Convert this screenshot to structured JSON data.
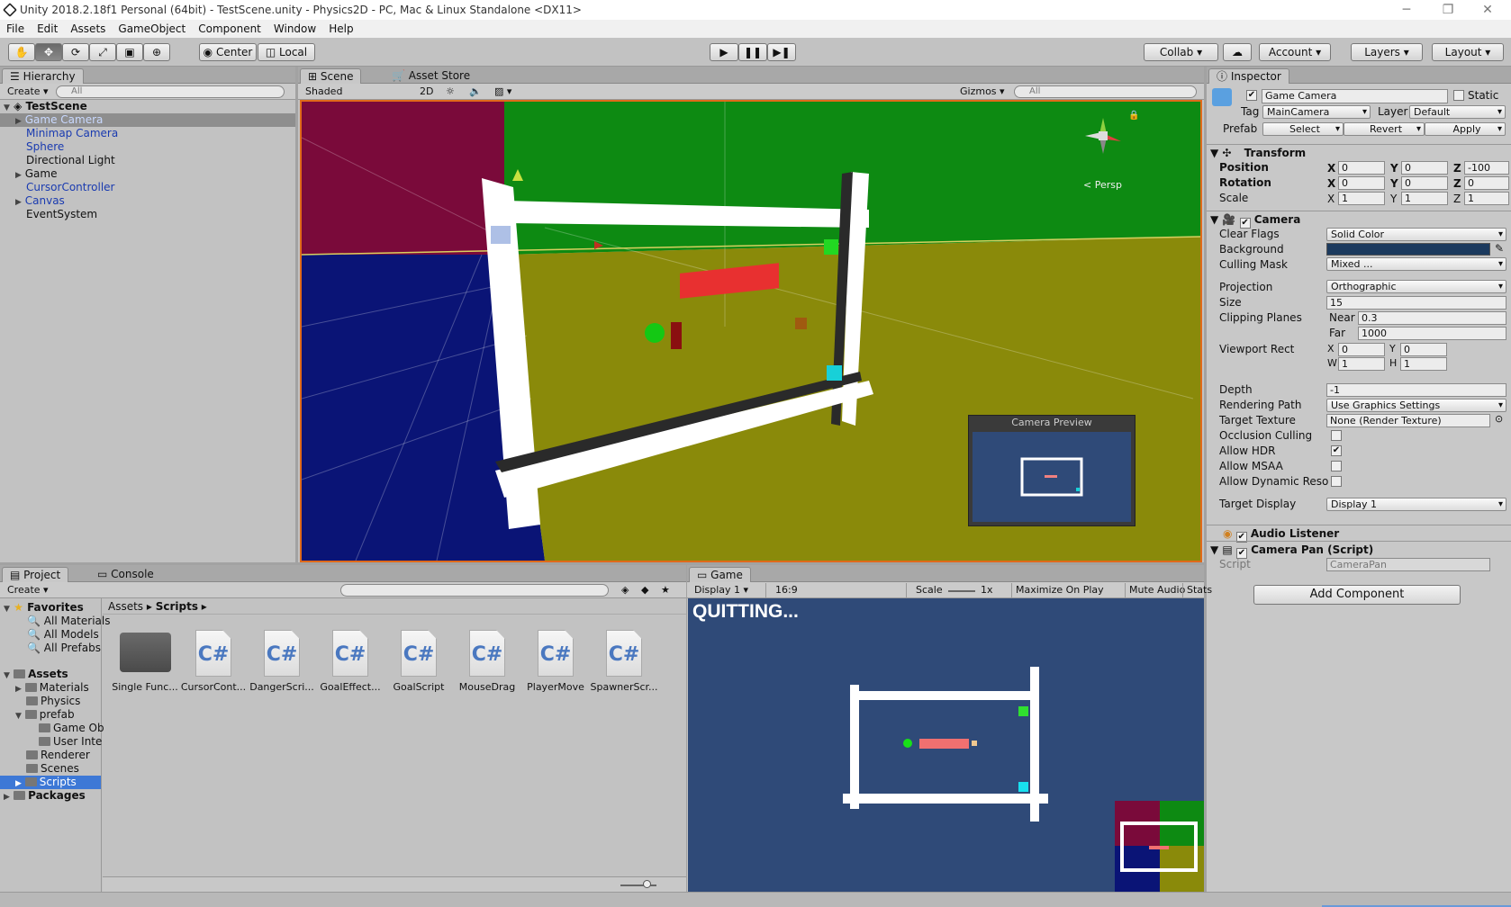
{
  "window": {
    "title": "Unity 2018.2.18f1 Personal (64bit) - TestScene.unity - Physics2D - PC, Mac & Linux Standalone <DX11>"
  },
  "menu": [
    "File",
    "Edit",
    "Assets",
    "GameObject",
    "Component",
    "Window",
    "Help"
  ],
  "toolbar": {
    "center": "Center",
    "local": "Local",
    "collab": "Collab",
    "account": "Account",
    "layers": "Layers",
    "layout": "Layout"
  },
  "hierarchy": {
    "tab": "Hierarchy",
    "create": "Create",
    "search": "All",
    "scene": "TestScene",
    "items": [
      {
        "label": "Game Camera"
      },
      {
        "label": "Minimap Camera"
      },
      {
        "label": "Sphere"
      },
      {
        "label": "Directional Light"
      },
      {
        "label": "Game"
      },
      {
        "label": "CursorController"
      },
      {
        "label": "Canvas"
      },
      {
        "label": "EventSystem"
      }
    ]
  },
  "scene": {
    "tab": "Scene",
    "asset_store": "Asset Store",
    "shading": "Shaded",
    "mode_2d": "2D",
    "gizmos": "Gizmos",
    "search": "All",
    "persp": "< Persp",
    "preview_title": "Camera Preview"
  },
  "inspector": {
    "tab": "Inspector",
    "name": "Game Camera",
    "static": "Static",
    "tag_label": "Tag",
    "tag": "MainCamera",
    "layer_label": "Layer",
    "layer": "Default",
    "prefab_label": "Prefab",
    "select": "Select",
    "revert": "Revert",
    "apply": "Apply",
    "transform": {
      "title": "Transform",
      "position": "Position",
      "rotation": "Rotation",
      "scale": "Scale",
      "pos": [
        "0",
        "0",
        "-100"
      ],
      "rot": [
        "0",
        "0",
        "0"
      ],
      "scl": [
        "1",
        "1",
        "1"
      ]
    },
    "camera": {
      "title": "Camera",
      "clear_flags": "Clear Flags",
      "clear_flags_v": "Solid Color",
      "background": "Background",
      "background_color": "#1c3a5e",
      "culling": "Culling Mask",
      "culling_v": "Mixed ...",
      "projection": "Projection",
      "projection_v": "Orthographic",
      "size": "Size",
      "size_v": "15",
      "clipping": "Clipping Planes",
      "near": "Near",
      "near_v": "0.3",
      "far": "Far",
      "far_v": "1000",
      "viewport": "Viewport Rect",
      "vx": "0",
      "vy": "0",
      "vw": "1",
      "vh": "1",
      "depth": "Depth",
      "depth_v": "-1",
      "rendering": "Rendering Path",
      "rendering_v": "Use Graphics Settings",
      "target_tex": "Target Texture",
      "target_tex_v": "None (Render Texture)",
      "occlusion": "Occlusion Culling",
      "hdr": "Allow HDR",
      "msaa": "Allow MSAA",
      "dyn": "Allow Dynamic Reso",
      "target_display": "Target Display",
      "target_display_v": "Display 1"
    },
    "audio": "Audio Listener",
    "pan": {
      "title": "Camera Pan (Script)",
      "script": "Script",
      "script_v": "CameraPan"
    },
    "add_component": "Add Component"
  },
  "project": {
    "tab": "Project",
    "console": "Console",
    "create": "Create",
    "breadcrumb": [
      "Assets",
      "Scripts"
    ],
    "favorites": "Favorites",
    "fav_items": [
      "All Materials",
      "All Models",
      "All Prefabs"
    ],
    "assets": "Assets",
    "asset_items": [
      "Materials",
      "Physics",
      "prefab",
      "Game Ob",
      "User Inte",
      "Renderer",
      "Scenes",
      "Scripts"
    ],
    "packages": "Packages",
    "files": [
      "Single Func...",
      "CursorCont...",
      "DangerScri...",
      "GoalEffect...",
      "GoalScript",
      "MouseDrag",
      "PlayerMove",
      "SpawnerScr..."
    ],
    "cs": "C#"
  },
  "game": {
    "tab": "Game",
    "display": "Display 1",
    "aspect": "16:9",
    "scale": "Scale",
    "scale_v": "1x",
    "maximize": "Maximize On Play",
    "mute": "Mute Audio",
    "stats": "Stats",
    "message": "QUITTING..."
  },
  "colors": {
    "accent_select": "#3d78d6",
    "game_bg": "#2f4a78",
    "scene_red": "#7a0a3a",
    "scene_green": "#0d8a12",
    "scene_blue": "#0a1476",
    "scene_olive": "#8a8a0a"
  }
}
